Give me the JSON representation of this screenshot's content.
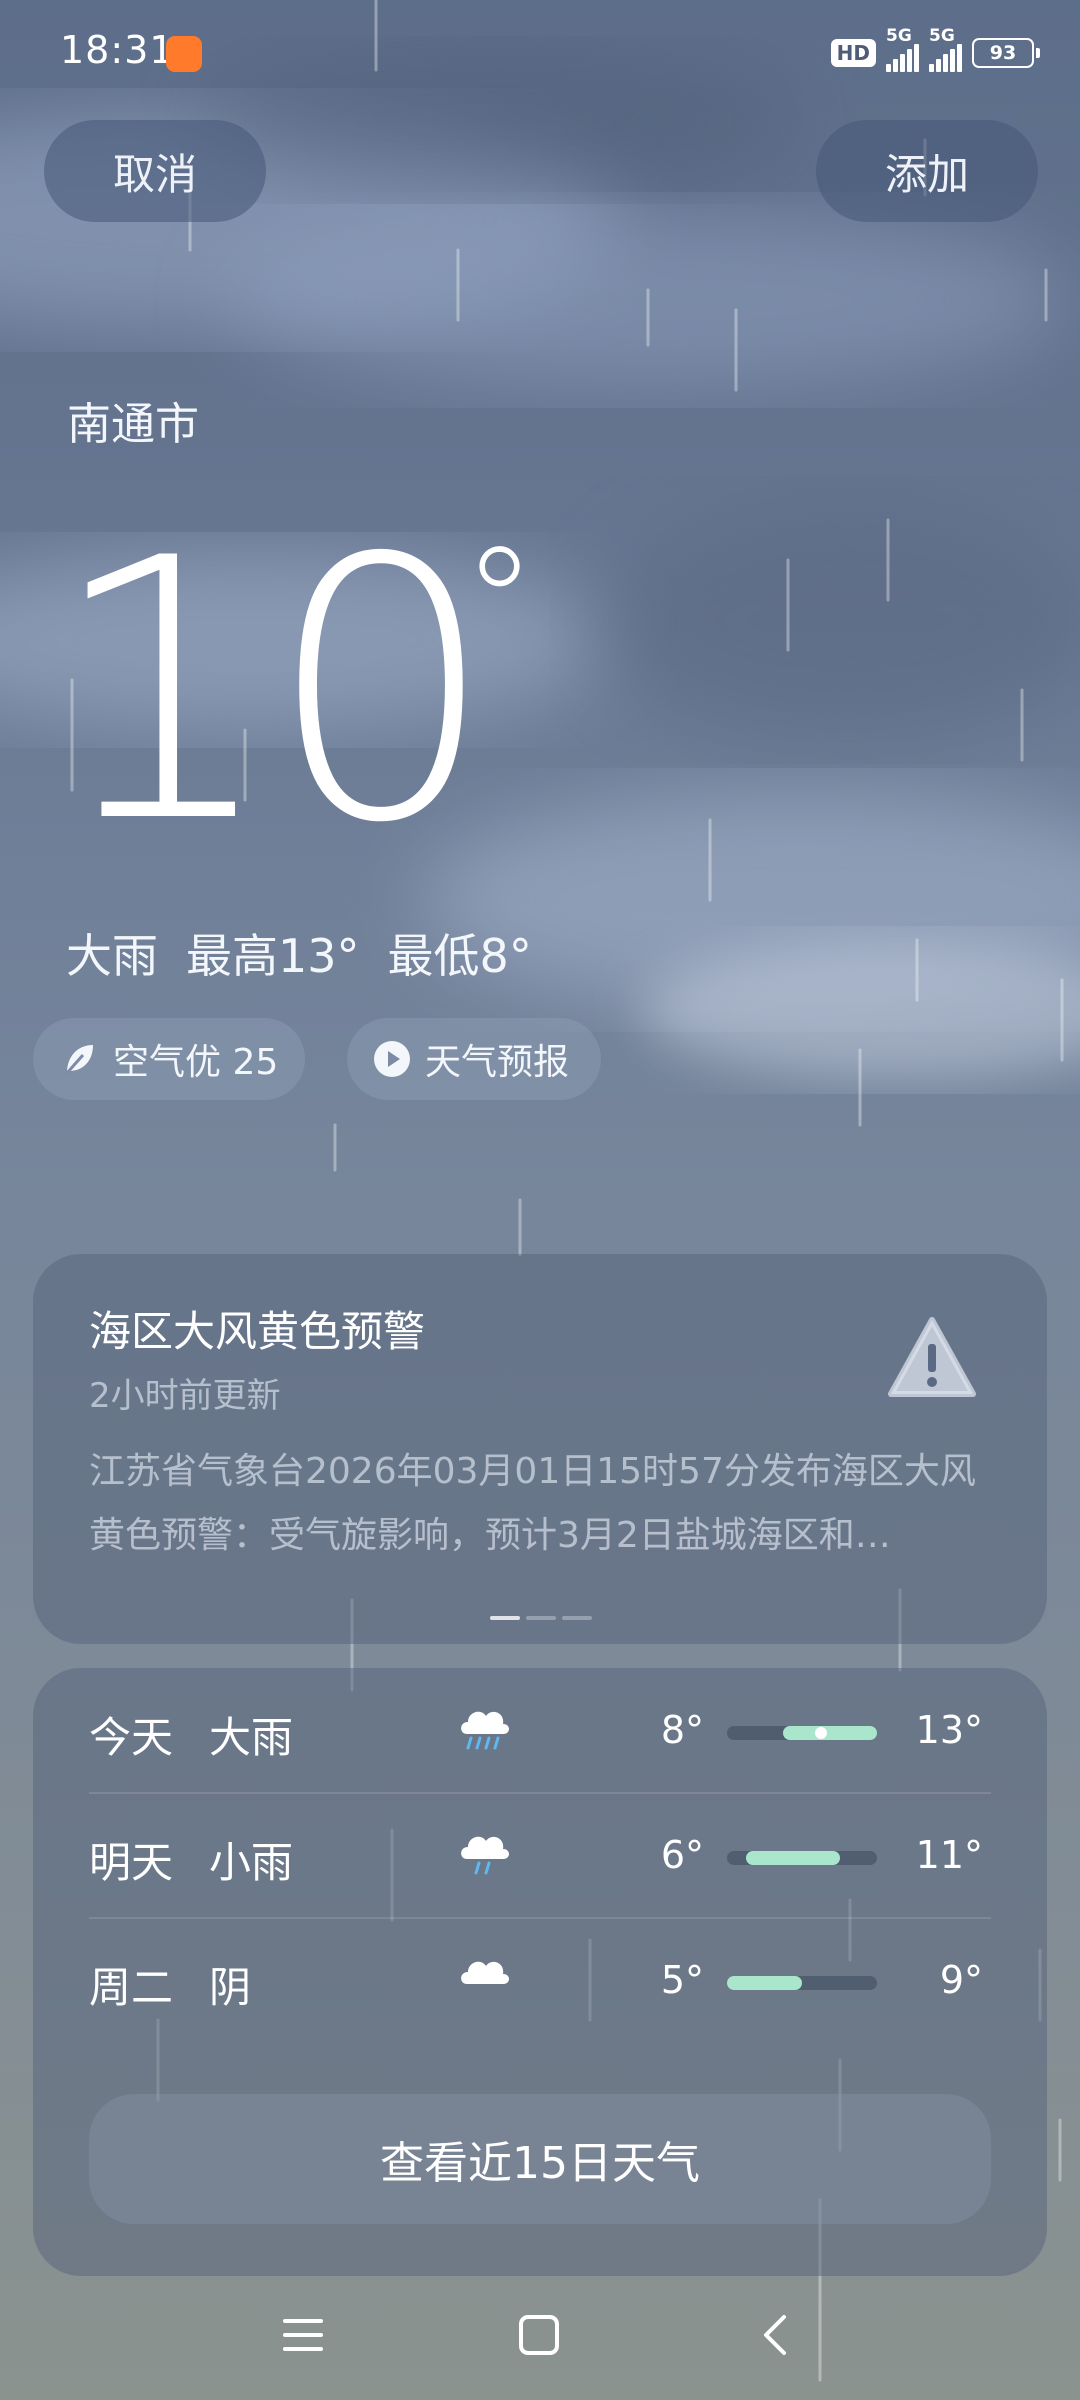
{
  "status_bar": {
    "time": "18:31",
    "hd_label": "HD",
    "net1_label": "5G",
    "net2_label": "5G",
    "battery": "93"
  },
  "header": {
    "cancel_label": "取消",
    "add_label": "添加"
  },
  "current": {
    "city": "南通市",
    "temperature": "10",
    "degree_symbol": "°",
    "condition": "大雨",
    "high": "最高13°",
    "low": "最低8°"
  },
  "chips": {
    "aqi_label": "空气优 25",
    "forecast_label": "天气预报"
  },
  "warning": {
    "title": "海区大风黄色预警",
    "updated": "2小时前更新",
    "text": "江苏省气象台2026年03月01日15时57分发布海区大风黄色预警：受气旋影响，预计3月2日盐城海区和…",
    "pages": 3,
    "active_page": 1
  },
  "forecast": {
    "days": [
      {
        "day": "今天",
        "condition": "大雨",
        "icon": "heavy-rain-icon",
        "low": "8°",
        "high": "13°",
        "range_min": 5,
        "range_max": 13,
        "low_value": 8,
        "high_value": 13,
        "current": 10
      },
      {
        "day": "明天",
        "condition": "小雨",
        "icon": "light-rain-icon",
        "low": "6°",
        "high": "11°",
        "range_min": 5,
        "range_max": 13,
        "low_value": 6,
        "high_value": 11,
        "current": null
      },
      {
        "day": "周二",
        "condition": "阴",
        "icon": "overcast-icon",
        "low": "5°",
        "high": "9°",
        "range_min": 5,
        "range_max": 13,
        "low_value": 5,
        "high_value": 9,
        "current": null
      }
    ],
    "more_label": "查看近15日天气"
  },
  "colors": {
    "range_fill": "#a9e6cc",
    "app_badge": "#ff7a2a"
  }
}
